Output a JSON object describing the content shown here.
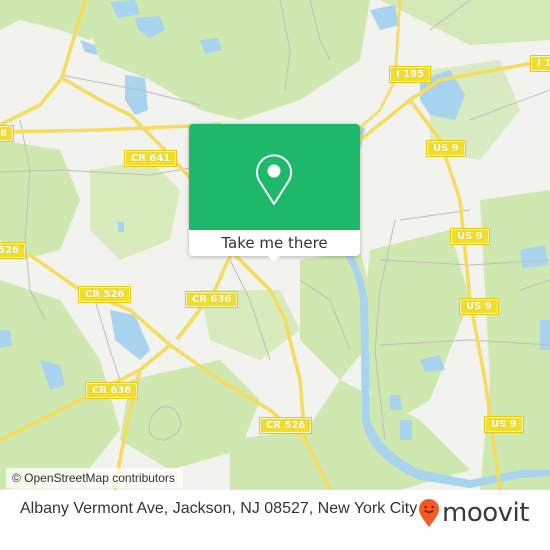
{
  "map": {
    "colors": {
      "land": "#f2f2ee",
      "park": "#cfe8b0",
      "water": "#a9d4ef",
      "major_road": "#f6dc5c",
      "minor_road": "#b9b9b9",
      "shield": "#f2dd2c"
    },
    "route_shields": [
      {
        "label": "I 195"
      },
      {
        "label": "I 1"
      },
      {
        "label": "8"
      },
      {
        "label": "CR 641"
      },
      {
        "label": "US 9"
      },
      {
        "label": "US 9"
      },
      {
        "label": "526"
      },
      {
        "label": "CR 526"
      },
      {
        "label": "CR 636"
      },
      {
        "label": "US 9"
      },
      {
        "label": "CR 636"
      },
      {
        "label": "US 9"
      },
      {
        "label": "CR 526"
      },
      {
        "label": "US 9"
      }
    ],
    "attribution": "© OpenStreetMap contributors"
  },
  "popup": {
    "icon": "location-pin-icon",
    "cta_label": "Take me there",
    "accent_color": "#1db86a"
  },
  "footer": {
    "address": "Albany Vermont Ave, Jackson, NJ 08527, New York City",
    "brand": {
      "name": "moovit",
      "icon": "moovit-smiley-pin-icon",
      "color": "#f15a24"
    }
  }
}
